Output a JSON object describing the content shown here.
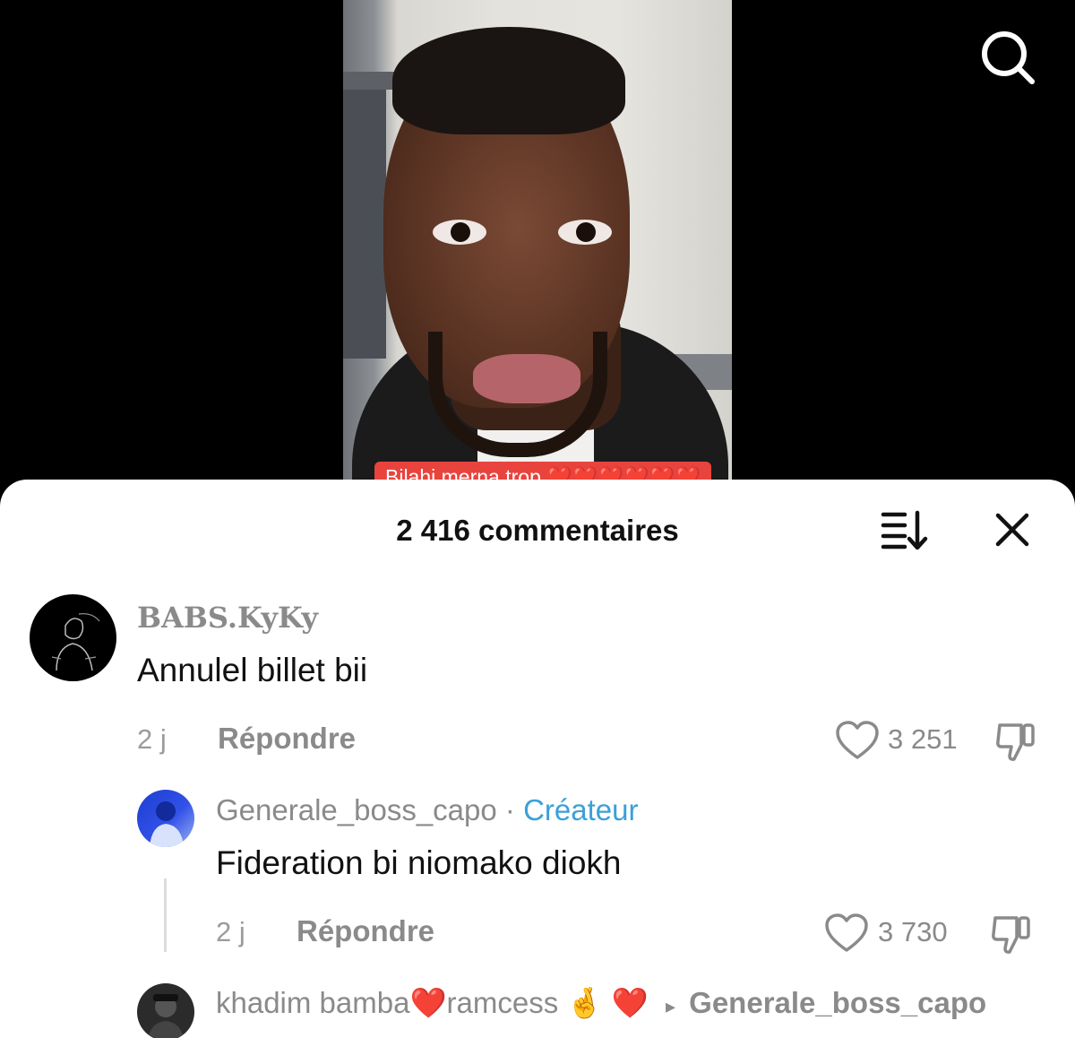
{
  "video": {
    "caption": "Bilahi merna trop ❤️❤️❤️❤️❤️❤️",
    "search_icon": "search-icon"
  },
  "comments_panel": {
    "title": "2 416 commentaires",
    "sort_icon": "sort-icon",
    "close_icon": "close-icon"
  },
  "comments": [
    {
      "username": "BABS.KyKy",
      "text": "Annulel billet bii",
      "time": "2 j",
      "reply_label": "Répondre",
      "likes": "3 251"
    }
  ],
  "replies": [
    {
      "username": "Generale_boss_capo",
      "separator": "·",
      "badge": "Créateur",
      "text": "Fideration bi niomako diokh",
      "time": "2 j",
      "reply_label": "Répondre",
      "likes": "3 730"
    },
    {
      "username_part1": "khadim bamba",
      "emoji1": "❤️",
      "username_part2": "ramcess",
      "emoji2": "🤞",
      "emoji3": "❤️",
      "reply_to": "Generale_boss_capo"
    }
  ]
}
